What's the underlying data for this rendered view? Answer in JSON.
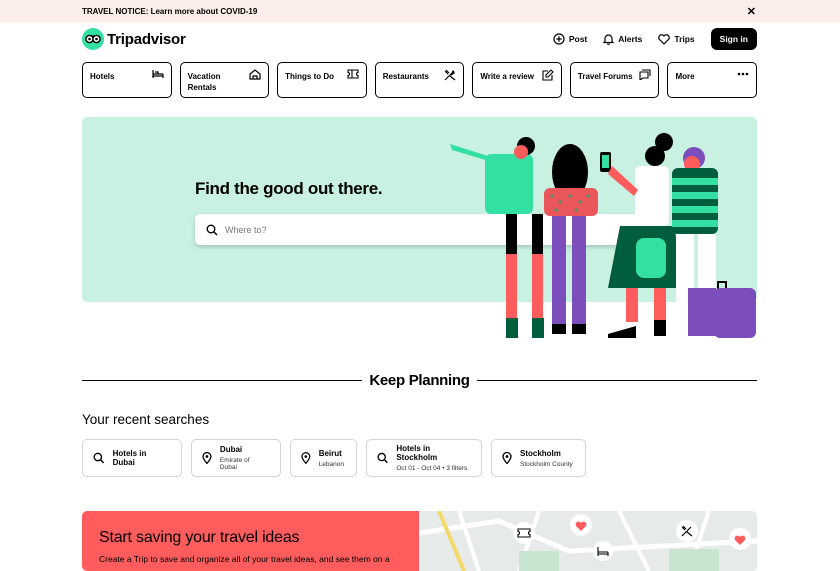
{
  "notice": {
    "text": "TRAVEL NOTICE: Learn more about COVID-19",
    "close": "✕"
  },
  "header": {
    "brand": "Tripadvisor",
    "post": "Post",
    "alerts": "Alerts",
    "trips": "Trips",
    "signin": "Sign in"
  },
  "categories": [
    {
      "label": "Hotels",
      "icon": "bed-icon"
    },
    {
      "label": "Vacation Rentals",
      "icon": "house-icon"
    },
    {
      "label": "Things to Do",
      "icon": "ticket-icon"
    },
    {
      "label": "Restaurants",
      "icon": "utensils-icon"
    },
    {
      "label": "Write a review",
      "icon": "edit-icon"
    },
    {
      "label": "Travel Forums",
      "icon": "chat-icon"
    },
    {
      "label": "More",
      "icon": "more-dots-icon"
    }
  ],
  "hero": {
    "title": "Find the good out there.",
    "search_placeholder": "Where to?"
  },
  "keep_planning": "Keep Planning",
  "recent": {
    "title": "Your recent searches",
    "items": [
      {
        "main": "Hotels in Dubai",
        "sub": "",
        "icon": "search-icon"
      },
      {
        "main": "Dubai",
        "sub": "Emirate of Dubai",
        "icon": "location-pin-icon"
      },
      {
        "main": "Beirut",
        "sub": "Lebanon",
        "icon": "location-pin-icon"
      },
      {
        "main": "Hotels in Stockholm",
        "sub": "Oct 01 - Oct 04 • 3 filters",
        "icon": "search-icon"
      },
      {
        "main": "Stockholm",
        "sub": "Stockholm County",
        "icon": "location-pin-icon"
      }
    ]
  },
  "save": {
    "title": "Start saving your travel ideas",
    "desc": "Create a Trip to save and organize all of your travel ideas, and see them on a"
  },
  "colors": {
    "brand_green": "#34e0a1",
    "hero_bg": "#c9f1e1",
    "save_red": "#ff5d5d",
    "notice_bg": "#fbeee9"
  }
}
